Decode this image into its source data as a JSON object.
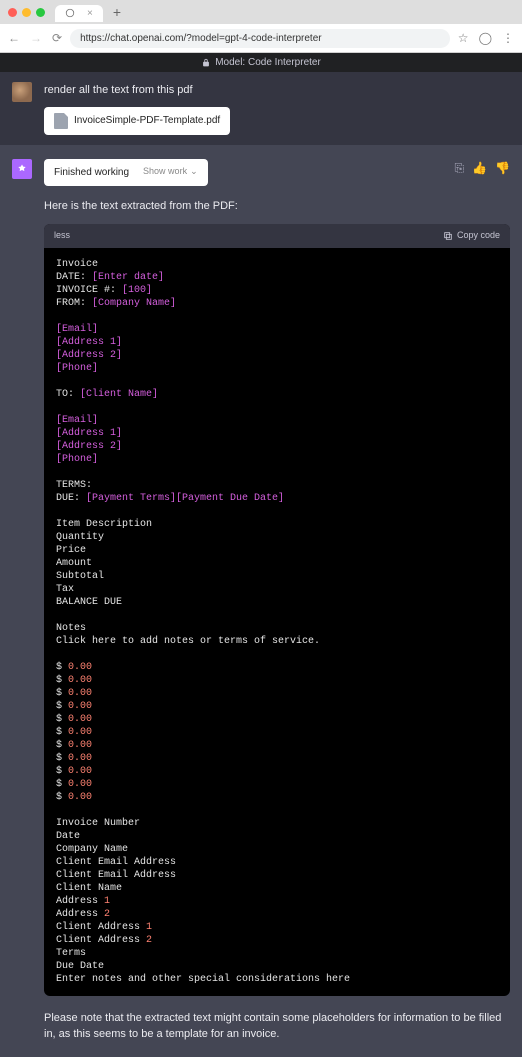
{
  "browser": {
    "url": "https://chat.openai.com/?model=gpt-4-code-interpreter",
    "tab_title": " "
  },
  "model_bar": "Model: Code Interpreter",
  "user_msg": "render all the text from this pdf",
  "file_name": "InvoiceSimple-PDF-Template.pdf",
  "status": {
    "finished": "Finished working",
    "show_work": "Show work"
  },
  "assistant_intro": "Here is the text extracted from the PDF:",
  "code_lang": "less",
  "copy_label": "Copy code",
  "code_lines": [
    {
      "p": "Invoice"
    },
    {
      "p": "DATE: ",
      "h": "[Enter date]"
    },
    {
      "p": "INVOICE #: ",
      "h": "[100]"
    },
    {
      "p": "FROM: ",
      "h": "[Company Name]"
    },
    {
      "p": ""
    },
    {
      "h": "[Email]"
    },
    {
      "h": "[Address 1]"
    },
    {
      "h": "[Address 2]"
    },
    {
      "h": "[Phone]"
    },
    {
      "p": ""
    },
    {
      "p": "TO: ",
      "h": "[Client Name]"
    },
    {
      "p": ""
    },
    {
      "h": "[Email]"
    },
    {
      "h": "[Address 1]"
    },
    {
      "h": "[Address 2]"
    },
    {
      "h": "[Phone]"
    },
    {
      "p": ""
    },
    {
      "p": "TERMS:"
    },
    {
      "p": "DUE: ",
      "h": "[Payment Terms][Payment Due Date]"
    },
    {
      "p": ""
    },
    {
      "p": "Item Description"
    },
    {
      "p": "Quantity"
    },
    {
      "p": "Price"
    },
    {
      "p": "Amount"
    },
    {
      "p": "Subtotal"
    },
    {
      "p": "Tax"
    },
    {
      "p": "BALANCE DUE"
    },
    {
      "p": ""
    },
    {
      "p": "Notes"
    },
    {
      "p": "Click here to add notes or terms of service."
    },
    {
      "p": ""
    },
    {
      "p": "$ ",
      "n": "0.00"
    },
    {
      "p": "$ ",
      "n": "0.00"
    },
    {
      "p": "$ ",
      "n": "0.00"
    },
    {
      "p": "$ ",
      "n": "0.00"
    },
    {
      "p": "$ ",
      "n": "0.00"
    },
    {
      "p": "$ ",
      "n": "0.00"
    },
    {
      "p": "$ ",
      "n": "0.00"
    },
    {
      "p": "$ ",
      "n": "0.00"
    },
    {
      "p": "$ ",
      "n": "0.00"
    },
    {
      "p": "$ ",
      "n": "0.00"
    },
    {
      "p": "$ ",
      "n": "0.00"
    },
    {
      "p": ""
    },
    {
      "p": "Invoice Number"
    },
    {
      "p": "Date"
    },
    {
      "p": "Company Name"
    },
    {
      "p": "Client Email Address"
    },
    {
      "p": "Client Email Address"
    },
    {
      "p": "Client Name"
    },
    {
      "p": "Address ",
      "n": "1"
    },
    {
      "p": "Address ",
      "n": "2"
    },
    {
      "p": "Client Address ",
      "n": "1"
    },
    {
      "p": "Client Address ",
      "n": "2"
    },
    {
      "p": "Terms"
    },
    {
      "p": "Due Date"
    },
    {
      "p": "Enter notes and other special considerations here"
    }
  ],
  "assistant_outro": "Please note that the extracted text might contain some placeholders for information to be filled in, as this seems to be a template for an invoice."
}
